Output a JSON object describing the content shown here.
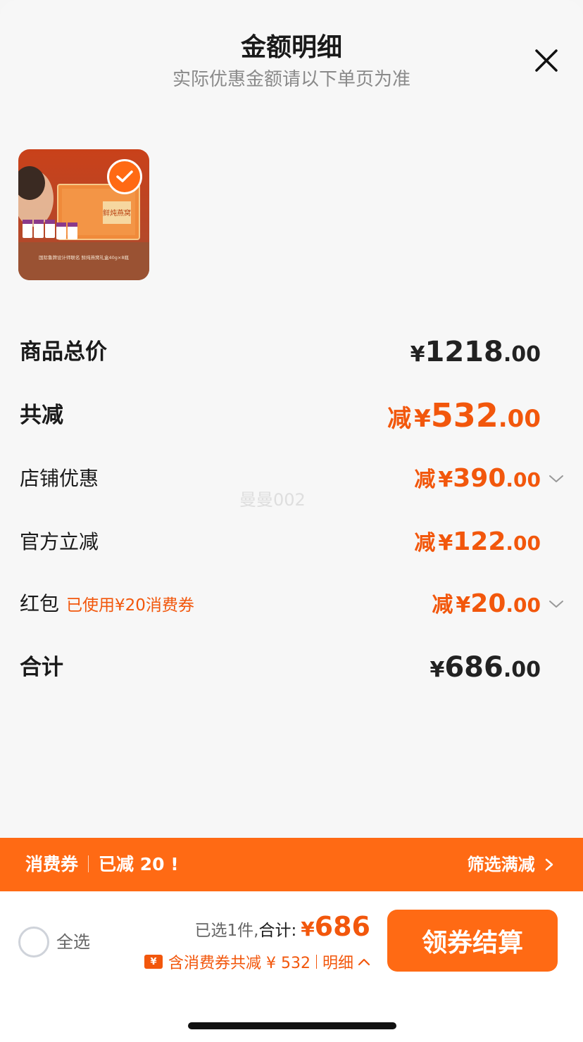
{
  "header": {
    "title": "金额明细",
    "subtitle": "实际优惠金额请以下单页为准"
  },
  "product": {
    "image_text": "鲜炖燕窝",
    "caption": "国际鲁牌设计师联名 鲜炖燕窝礼盒40g×8瓶"
  },
  "rows": [
    {
      "label": "商品总价",
      "prefix": "",
      "currency": "¥",
      "int": "1218",
      "dec": ".00",
      "tone": "black"
    },
    {
      "label": "共减",
      "prefix": "减",
      "currency": "¥",
      "int": "532",
      "dec": ".00",
      "tone": "orange"
    },
    {
      "label": "店铺优惠",
      "prefix": "减",
      "currency": "¥",
      "int": "390",
      "dec": ".00",
      "tone": "orange"
    },
    {
      "label": "官方立减",
      "prefix": "减",
      "currency": "¥",
      "int": "122",
      "dec": ".00",
      "tone": "orange"
    },
    {
      "label": "红包",
      "note": "已使用¥20消费券",
      "prefix": "减",
      "currency": "¥",
      "int": "20",
      "dec": ".00",
      "tone": "orange"
    },
    {
      "label": "合计",
      "prefix": "",
      "currency": "¥",
      "int": "686",
      "dec": ".00",
      "tone": "black"
    }
  ],
  "watermark": "曼曼002",
  "promo": {
    "left_a": "消费券",
    "left_b": "已减 20 !",
    "right": "筛选满减"
  },
  "bottom": {
    "select_all": "全选",
    "selected": "已选1件,",
    "total_label": "合计:",
    "total_currency": "¥",
    "total_value": "686",
    "ticket_icon": "¥",
    "detail_text": "含消费券共减 ¥ 532",
    "detail_link": "明细",
    "checkout": "领券结算"
  },
  "colors": {
    "accent": "#ff6a14",
    "discount_text": "#f2570c"
  }
}
